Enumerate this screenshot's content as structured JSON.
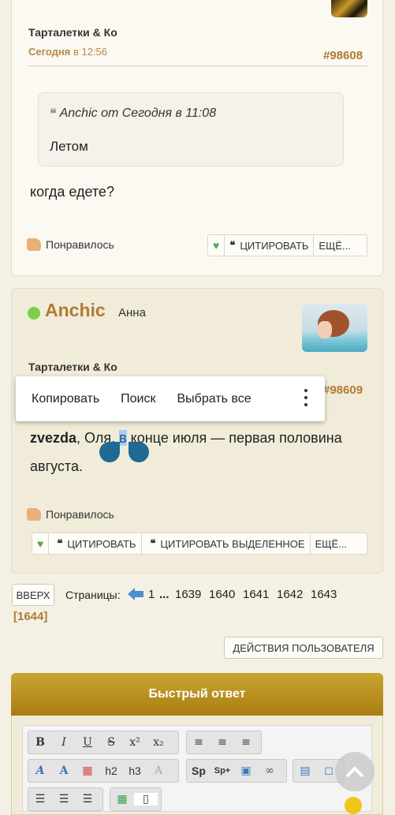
{
  "post1": {
    "group": "Тарталетки & Ко",
    "time_day": "Сегодня",
    "time_rest": " в 12:56",
    "post_id": "#98608",
    "quote_header": "Anchic от Сегодня в 11:08",
    "quote_text": "Летом",
    "body": "когда едете?",
    "like_label": "Понравилось",
    "quote_btn": "ЦИТИРОВАТЬ",
    "more_btn": "ЕЩЁ..."
  },
  "post2": {
    "username": "Anchic",
    "realname": "Анна",
    "group": "Тарталетки & Ко",
    "post_id": "#98609",
    "body_bold": "zvezda",
    "body_pre": ", Оля, ",
    "body_sel": "в",
    "body_post": " конце июля — первая половина",
    "body_line2": "августа.",
    "like_label": "Понравилось",
    "quote_btn": "ЦИТИРОВАТЬ",
    "quote_sel_btn": "ЦИТИРОВАТЬ ВЫДЕЛЕННОЕ",
    "more_btn": "ЕЩЁ..."
  },
  "context_menu": {
    "copy": "Копировать",
    "search": "Поиск",
    "select_all": "Выбрать все"
  },
  "pagination": {
    "up": "ВВЕРХ",
    "label": "Страницы:",
    "first": "1",
    "dots": "...",
    "pages": [
      "1639",
      "1640",
      "1641",
      "1642",
      "1643"
    ],
    "current": "[1644]"
  },
  "user_actions": "ДЕЙСТВИЯ ПОЛЬЗОВАТЕЛЯ",
  "quick_reply": {
    "title": "Быстрый ответ"
  },
  "colors": {
    "accent": "#b07b33",
    "online": "#7ccf4e",
    "header_gold": "#b88f16"
  }
}
